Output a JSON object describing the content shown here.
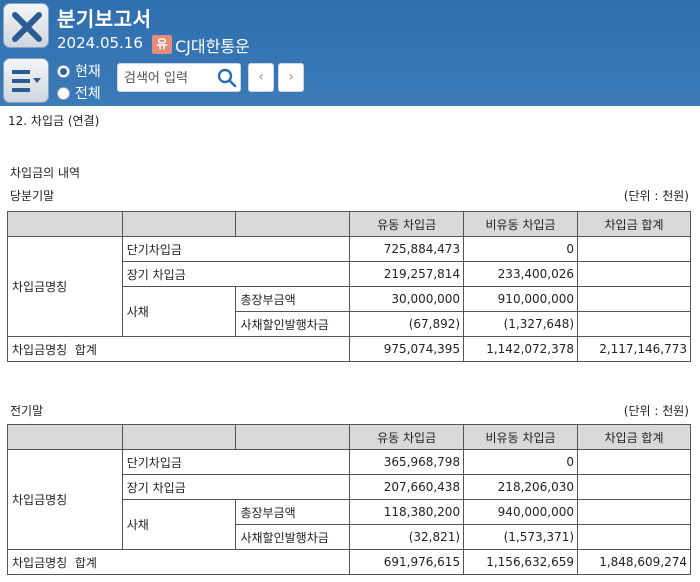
{
  "header": {
    "title": "분기보고서",
    "date": "2024.05.16",
    "market_badge": "유",
    "company": "CJ대한통운",
    "radio_current": "현재",
    "radio_all": "전체",
    "search_placeholder": "검색어 입력",
    "prev_label": "‹",
    "next_label": "›"
  },
  "content": {
    "section_title": "12. 차입금 (연결)",
    "sub_title": "차입금의 내역",
    "tables": [
      {
        "period": "당분기말",
        "unit": "(단위 : 천원)",
        "headers": [
          "",
          "",
          "",
          "유동 차입금",
          "비유동 차입금",
          "차입금 합계"
        ],
        "group_label": "차입금명칭",
        "short_term": {
          "label": "단기차입금",
          "current": "725,884,473",
          "noncurrent": "0",
          "total": ""
        },
        "long_term": {
          "label": "장기 차입금",
          "current": "219,257,814",
          "noncurrent": "233,400,026",
          "total": ""
        },
        "bond_label": "사채",
        "bond_face": {
          "label": "총장부금액",
          "current": "30,000,000",
          "noncurrent": "910,000,000",
          "total": ""
        },
        "bond_discount": {
          "label": "사채할인발행차금",
          "current": "(67,892)",
          "noncurrent": "(1,327,648)",
          "total": ""
        },
        "sum": {
          "label": "차입금명칭  합계",
          "current": "975,074,395",
          "noncurrent": "1,142,072,378",
          "total": "2,117,146,773"
        }
      },
      {
        "period": "전기말",
        "unit": "(단위 : 천원)",
        "headers": [
          "",
          "",
          "",
          "유동 차입금",
          "비유동 차입금",
          "차입금 합계"
        ],
        "group_label": "차입금명칭",
        "short_term": {
          "label": "단기차입금",
          "current": "365,968,798",
          "noncurrent": "0",
          "total": ""
        },
        "long_term": {
          "label": "장기 차입금",
          "current": "207,660,438",
          "noncurrent": "218,206,030",
          "total": ""
        },
        "bond_label": "사채",
        "bond_face": {
          "label": "총장부금액",
          "current": "118,380,200",
          "noncurrent": "940,000,000",
          "total": ""
        },
        "bond_discount": {
          "label": "사채할인발행차금",
          "current": "(32,821)",
          "noncurrent": "(1,573,371)",
          "total": ""
        },
        "sum": {
          "label": "차입금명칭  합계",
          "current": "691,976,615",
          "noncurrent": "1,156,632,659",
          "total": "1,848,609,274"
        }
      }
    ]
  }
}
